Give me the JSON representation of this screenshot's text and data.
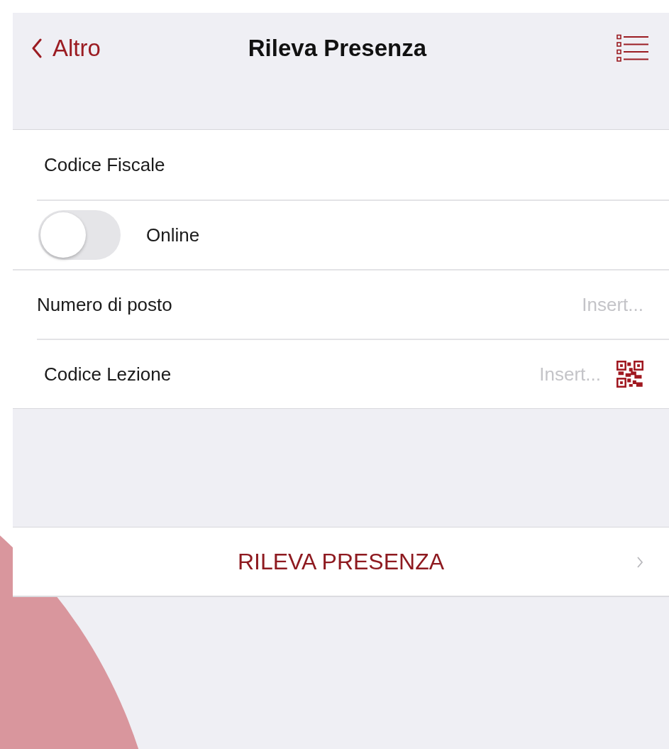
{
  "nav": {
    "back_label": "Altro",
    "title": "Rileva Presenza"
  },
  "form_rows": [
    {
      "kind": "field",
      "label": "Codice Fiscale"
    },
    {
      "kind": "toggle",
      "label": "Online",
      "on": false
    },
    {
      "kind": "field",
      "label": "Numero di posto",
      "placeholder": "Insert..."
    },
    {
      "kind": "scan",
      "label": "Codice Lezione",
      "placeholder": "Insert..."
    }
  ],
  "action": {
    "label": "RILEVA PRESENZA"
  }
}
